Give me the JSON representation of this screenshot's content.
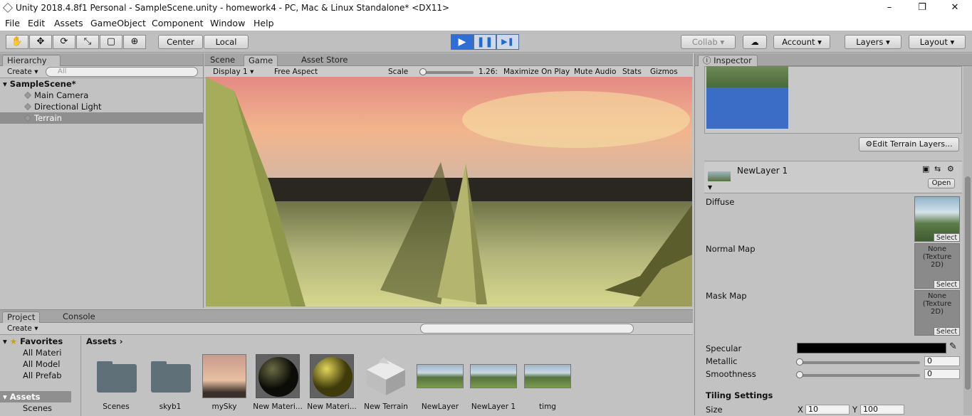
{
  "window": {
    "title": "Unity 2018.4.8f1 Personal - SampleScene.unity - homework4 - PC, Mac & Linux Standalone* <DX11>",
    "minimize": "–",
    "maximize": "❐",
    "close": "✕"
  },
  "menu": [
    "File",
    "Edit",
    "Assets",
    "GameObject",
    "Component",
    "Window",
    "Help"
  ],
  "toolbar": {
    "tools": [
      "✋",
      "✥",
      "⟳",
      "⤡",
      "▢",
      "⊕"
    ],
    "center": "Center",
    "local": "Local",
    "play": "▶",
    "pause": "❚❚",
    "step": "▶❚",
    "collab": "Collab",
    "account": "Account",
    "layers": "Layers",
    "layout": "Layout",
    "cloud": "☁"
  },
  "hierarchy": {
    "tab": "Hierarchy",
    "create": "Create",
    "search_placeholder": "All",
    "scene": "SampleScene*",
    "items": [
      "Main Camera",
      "Directional Light",
      "Terrain"
    ]
  },
  "game": {
    "tabs": [
      "Scene",
      "Game",
      "Asset Store"
    ],
    "display": "Display 1",
    "aspect": "Free Aspect",
    "scale_label": "Scale",
    "scale_value": "1.26:",
    "maximize": "Maximize On Play",
    "mute": "Mute Audio",
    "stats": "Stats",
    "gizmos": "Gizmos"
  },
  "project": {
    "tabs": [
      "Project",
      "Console"
    ],
    "create": "Create",
    "favorites": "Favorites",
    "fav_items": [
      "All Materi",
      "All Model",
      "All Prefab"
    ],
    "assets_root": "Assets",
    "folders": [
      "Scenes"
    ],
    "breadcrumb": "Assets",
    "assets": [
      {
        "name": "Scenes",
        "kind": "folder"
      },
      {
        "name": "skyb1",
        "kind": "folder"
      },
      {
        "name": "mySky",
        "kind": "sky"
      },
      {
        "name": "New Materi...",
        "kind": "black-sphere"
      },
      {
        "name": "New Materi...",
        "kind": "yellow-sphere"
      },
      {
        "name": "New Terrain",
        "kind": "terrain"
      },
      {
        "name": "NewLayer",
        "kind": "layer"
      },
      {
        "name": "NewLayer 1",
        "kind": "layer"
      },
      {
        "name": "timg",
        "kind": "layer"
      }
    ]
  },
  "inspector": {
    "tab": "Inspector",
    "edit_layers": "Edit Terrain Layers...",
    "layer_name": "NewLayer 1",
    "open": "Open",
    "diffuse": "Diffuse",
    "normal_map": "Normal Map",
    "mask_map": "Mask Map",
    "none_tex": "None (Texture 2D)",
    "select": "Select",
    "specular": "Specular",
    "metallic": "Metallic",
    "metallic_value": "0",
    "smoothness": "Smoothness",
    "smoothness_value": "0",
    "tiling": "Tiling Settings",
    "size": "Size",
    "size_x_label": "X",
    "size_x": "10",
    "size_y_label": "Y",
    "size_y": "100"
  }
}
